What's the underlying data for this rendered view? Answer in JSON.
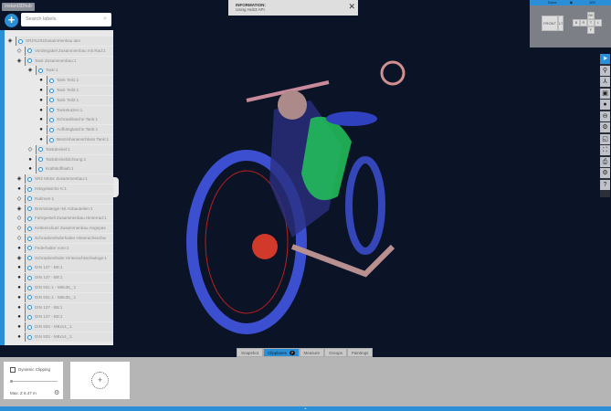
{
  "app": {
    "logo": "instant3Dhub"
  },
  "search": {
    "placeholder": "Search labels"
  },
  "tree": [
    {
      "label": "SR2%202Zusammenbau.iam",
      "level": 0,
      "eye": "partial"
    },
    {
      "label": "Vordergabel Zusammenbau mit Rad:1",
      "level": 1,
      "eye": "hidden"
    },
    {
      "label": "Tank Zusammenbau:1",
      "level": 1,
      "eye": "partial"
    },
    {
      "label": "Tank:1",
      "level": 2,
      "eye": "partial"
    },
    {
      "label": "Tank Teil1:1",
      "level": 3,
      "eye": "visible"
    },
    {
      "label": "Tank Teil3:1",
      "level": 3,
      "eye": "visible"
    },
    {
      "label": "Tank Teil2:1",
      "level": 3,
      "eye": "visible"
    },
    {
      "label": "Tankstutzen:1",
      "level": 3,
      "eye": "visible"
    },
    {
      "label": "Schraublasche Tank:1",
      "level": 3,
      "eye": "visible"
    },
    {
      "label": "Aufhänglasche Tank:1",
      "level": 3,
      "eye": "visible"
    },
    {
      "label": "Benzinhananschluss Tank:1",
      "level": 3,
      "eye": "visible"
    },
    {
      "label": "Tankdeckel:1",
      "level": 2,
      "eye": "hidden"
    },
    {
      "label": "Tankdeckeldichtung:1",
      "level": 2,
      "eye": "visible"
    },
    {
      "label": "Kraftstoffsieb:1",
      "level": 2,
      "eye": "visible"
    },
    {
      "label": "SR2 Motor Zusammenbau:1",
      "level": 1,
      "eye": "partial"
    },
    {
      "label": "Hängelasche K:1",
      "level": 1,
      "eye": "visible"
    },
    {
      "label": "Rahmen:1",
      "level": 1,
      "eye": "hidden"
    },
    {
      "label": "Bremsstange mit Anbauteilen:1",
      "level": 1,
      "eye": "partial"
    },
    {
      "label": "Fahrgestell Zusammenbau Hinterrad:1",
      "level": 1,
      "eye": "hidden"
    },
    {
      "label": "Kettenschutz Zusammenbau Angepas",
      "level": 1,
      "eye": "hidden"
    },
    {
      "label": "Schraubenfederhalter Hinterachsschw",
      "level": 1,
      "eye": "hidden"
    },
    {
      "label": "Federhalter vorn:1",
      "level": 1,
      "eye": "visible"
    },
    {
      "label": "Schraubenfeder Hinterachsschwinge:1",
      "level": 1,
      "eye": "partial"
    },
    {
      "label": "DIN 137 - B8:1",
      "level": 1,
      "eye": "visible"
    },
    {
      "label": "DIN 137 - B8:1",
      "level": 1,
      "eye": "visible"
    },
    {
      "label": "DIN 931-1 - M8x35_:1",
      "level": 1,
      "eye": "visible"
    },
    {
      "label": "DIN 931-1 - M8x35_:1",
      "level": 1,
      "eye": "visible"
    },
    {
      "label": "DIN 137 - B8:1",
      "level": 1,
      "eye": "visible"
    },
    {
      "label": "DIN 137 - B8:1",
      "level": 1,
      "eye": "visible"
    },
    {
      "label": "DIN 933 - M8x14_:1",
      "level": 1,
      "eye": "visible"
    },
    {
      "label": "DIN 933 - M8x14_:1",
      "level": 1,
      "eye": "visible"
    }
  ],
  "info": {
    "title": "INFORMATION:",
    "message": "Using Hub3 API",
    "close": "✕"
  },
  "viewcube": {
    "mode": "Done",
    "value": "100",
    "front": "FRONT",
    "side": "LT",
    "nav": {
      "top": "BK",
      "left": "B",
      "center": "R",
      "right2": "T",
      "right": "L",
      "bottom": "F"
    }
  },
  "toolbar": [
    "select",
    "measure",
    "tree",
    "snapshot",
    "explode",
    "clipping",
    "materials",
    "fit",
    "fullscreen",
    "print",
    "settings",
    "help"
  ],
  "bottom_tabs": [
    {
      "label": "Snapshot"
    },
    {
      "label": "Clipplanes",
      "active": true,
      "badge": "?"
    },
    {
      "label": "Measure"
    },
    {
      "label": "Groups"
    },
    {
      "label": "Paintings"
    }
  ],
  "clipping": {
    "dynamic_label": "Dynamic Clipping",
    "dynamic_checked": false,
    "slider_value": 0,
    "max_label": "Max. Z 6.47 m",
    "add_label": "+"
  },
  "colors": {
    "accent": "#2a8fd6",
    "background": "#0b1326",
    "panel": "#b5b5b5"
  }
}
